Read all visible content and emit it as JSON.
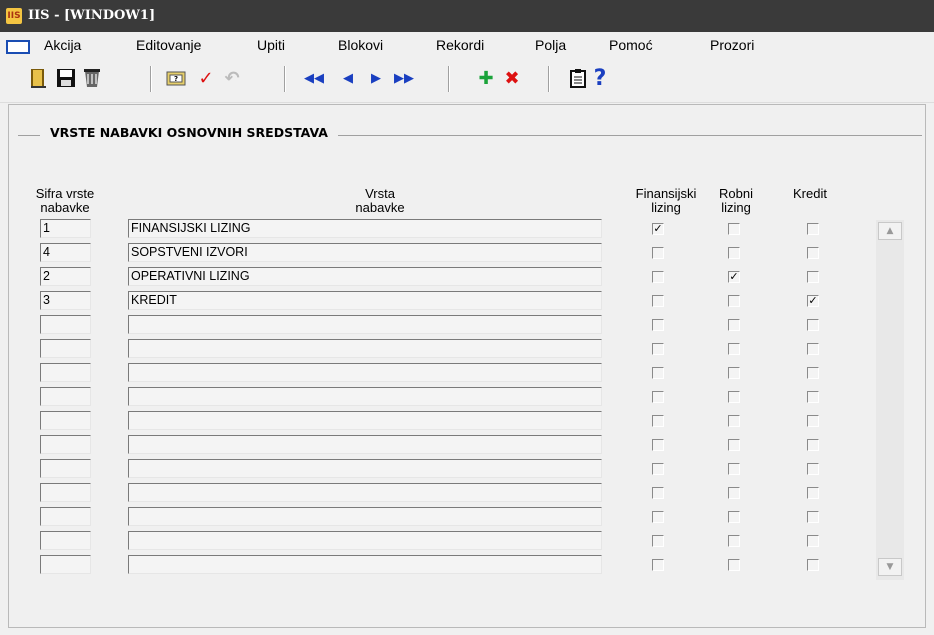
{
  "window": {
    "title": "IIS - [WINDOW1]",
    "app_icon_text": "IIS"
  },
  "menu": [
    "Akcija",
    "Editovanje",
    "Upiti",
    "Blokovi",
    "Rekordi",
    "Polja",
    "Pomoć",
    "Prozori"
  ],
  "toolbar": {
    "icons": [
      "exit-icon",
      "save-icon",
      "print-icon",
      "query-icon",
      "execute-check-icon",
      "undo-icon",
      "first-record-icon",
      "previous-record-icon",
      "next-record-icon",
      "last-record-icon",
      "insert-record-icon",
      "delete-record-icon",
      "list-icon",
      "help-icon"
    ],
    "glyphs": {
      "check": "✓",
      "undo": "↶",
      "first": "◀◀",
      "prev": "◀",
      "next": "▶",
      "last": "▶▶",
      "plus": "✚",
      "delete": "✖",
      "help": "?"
    }
  },
  "form": {
    "title": "VRSTE NABAVKI OSNOVNIH SREDSTAVA",
    "headers": {
      "code_line1": "Sifra vrste",
      "code_line2": "nabavke",
      "name_line1": "Vrsta",
      "name_line2": "nabavke",
      "fin_line1": "Finansijski",
      "fin_line2": "lizing",
      "robni_line1": "Robni",
      "robni_line2": "lizing",
      "kredit": "Kredit"
    },
    "rows": [
      {
        "code": "1",
        "name": "FINANSIJSKI LIZING",
        "finansijski": true,
        "robni": false,
        "kredit": false
      },
      {
        "code": "4",
        "name": "SOPSTVENI IZVORI",
        "finansijski": false,
        "robni": false,
        "kredit": false
      },
      {
        "code": "2",
        "name": "OPERATIVNI LIZING",
        "finansijski": false,
        "robni": true,
        "kredit": false
      },
      {
        "code": "3",
        "name": "KREDIT",
        "finansijski": false,
        "robni": false,
        "kredit": true
      },
      {
        "code": "",
        "name": "",
        "finansijski": false,
        "robni": false,
        "kredit": false
      },
      {
        "code": "",
        "name": "",
        "finansijski": false,
        "robni": false,
        "kredit": false
      },
      {
        "code": "",
        "name": "",
        "finansijski": false,
        "robni": false,
        "kredit": false
      },
      {
        "code": "",
        "name": "",
        "finansijski": false,
        "robni": false,
        "kredit": false
      },
      {
        "code": "",
        "name": "",
        "finansijski": false,
        "robni": false,
        "kredit": false
      },
      {
        "code": "",
        "name": "",
        "finansijski": false,
        "robni": false,
        "kredit": false
      },
      {
        "code": "",
        "name": "",
        "finansijski": false,
        "robni": false,
        "kredit": false
      },
      {
        "code": "",
        "name": "",
        "finansijski": false,
        "robni": false,
        "kredit": false
      },
      {
        "code": "",
        "name": "",
        "finansijski": false,
        "robni": false,
        "kredit": false
      },
      {
        "code": "",
        "name": "",
        "finansijski": false,
        "robni": false,
        "kredit": false
      },
      {
        "code": "",
        "name": "",
        "finansijski": false,
        "robni": false,
        "kredit": false
      }
    ]
  },
  "scrollbar": {
    "up": "▲",
    "down": "▼"
  }
}
